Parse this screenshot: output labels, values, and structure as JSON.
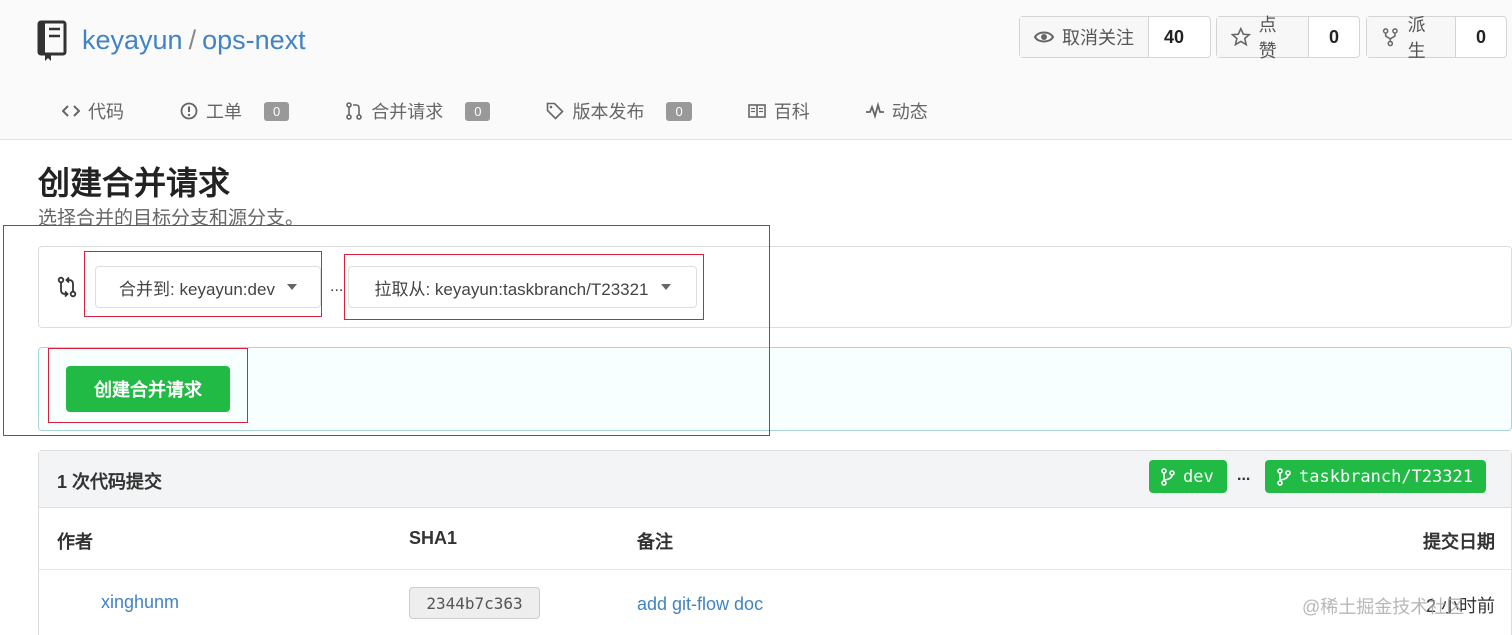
{
  "repo": {
    "owner": "keyayun",
    "separator": "/",
    "name": "ops-next"
  },
  "actions": {
    "watch": {
      "label": "取消关注",
      "count": "40",
      "icon": "eye-icon"
    },
    "star": {
      "label": "点赞",
      "count": "0",
      "icon": "star-icon"
    },
    "fork": {
      "label": "派生",
      "count": "0",
      "icon": "fork-icon"
    }
  },
  "tabs": [
    {
      "label": "代码",
      "icon": "code-icon"
    },
    {
      "label": "工单",
      "icon": "issue-icon",
      "badge": "0"
    },
    {
      "label": "合并请求",
      "icon": "pull-request-icon",
      "badge": "0"
    },
    {
      "label": "版本发布",
      "icon": "tag-icon",
      "badge": "0"
    },
    {
      "label": "百科",
      "icon": "book-icon"
    },
    {
      "label": "动态",
      "icon": "pulse-icon"
    }
  ],
  "page": {
    "title": "创建合并请求",
    "subtitle": "选择合并的目标分支和源分支。"
  },
  "compare": {
    "base_label": "合并到: keyayun:dev",
    "separator": "...",
    "head_label": "拉取从: keyayun:taskbranch/T23321"
  },
  "create_button": "创建合并请求",
  "commits": {
    "count_label": "1 次代码提交",
    "base_branch": "dev",
    "dots": "...",
    "head_branch": "taskbranch/T23321",
    "columns": {
      "author": "作者",
      "sha": "SHA1",
      "message": "备注",
      "date": "提交日期"
    },
    "rows": [
      {
        "author": "xinghunm",
        "sha": "2344b7c363",
        "message": "add git-flow doc",
        "date": "2 小时前"
      }
    ]
  },
  "watermark": "@稀土掘金技术社区",
  "colors": {
    "accent_green": "#21ba45",
    "link_blue": "#4183c4",
    "annotation_red": "#d9213d"
  }
}
